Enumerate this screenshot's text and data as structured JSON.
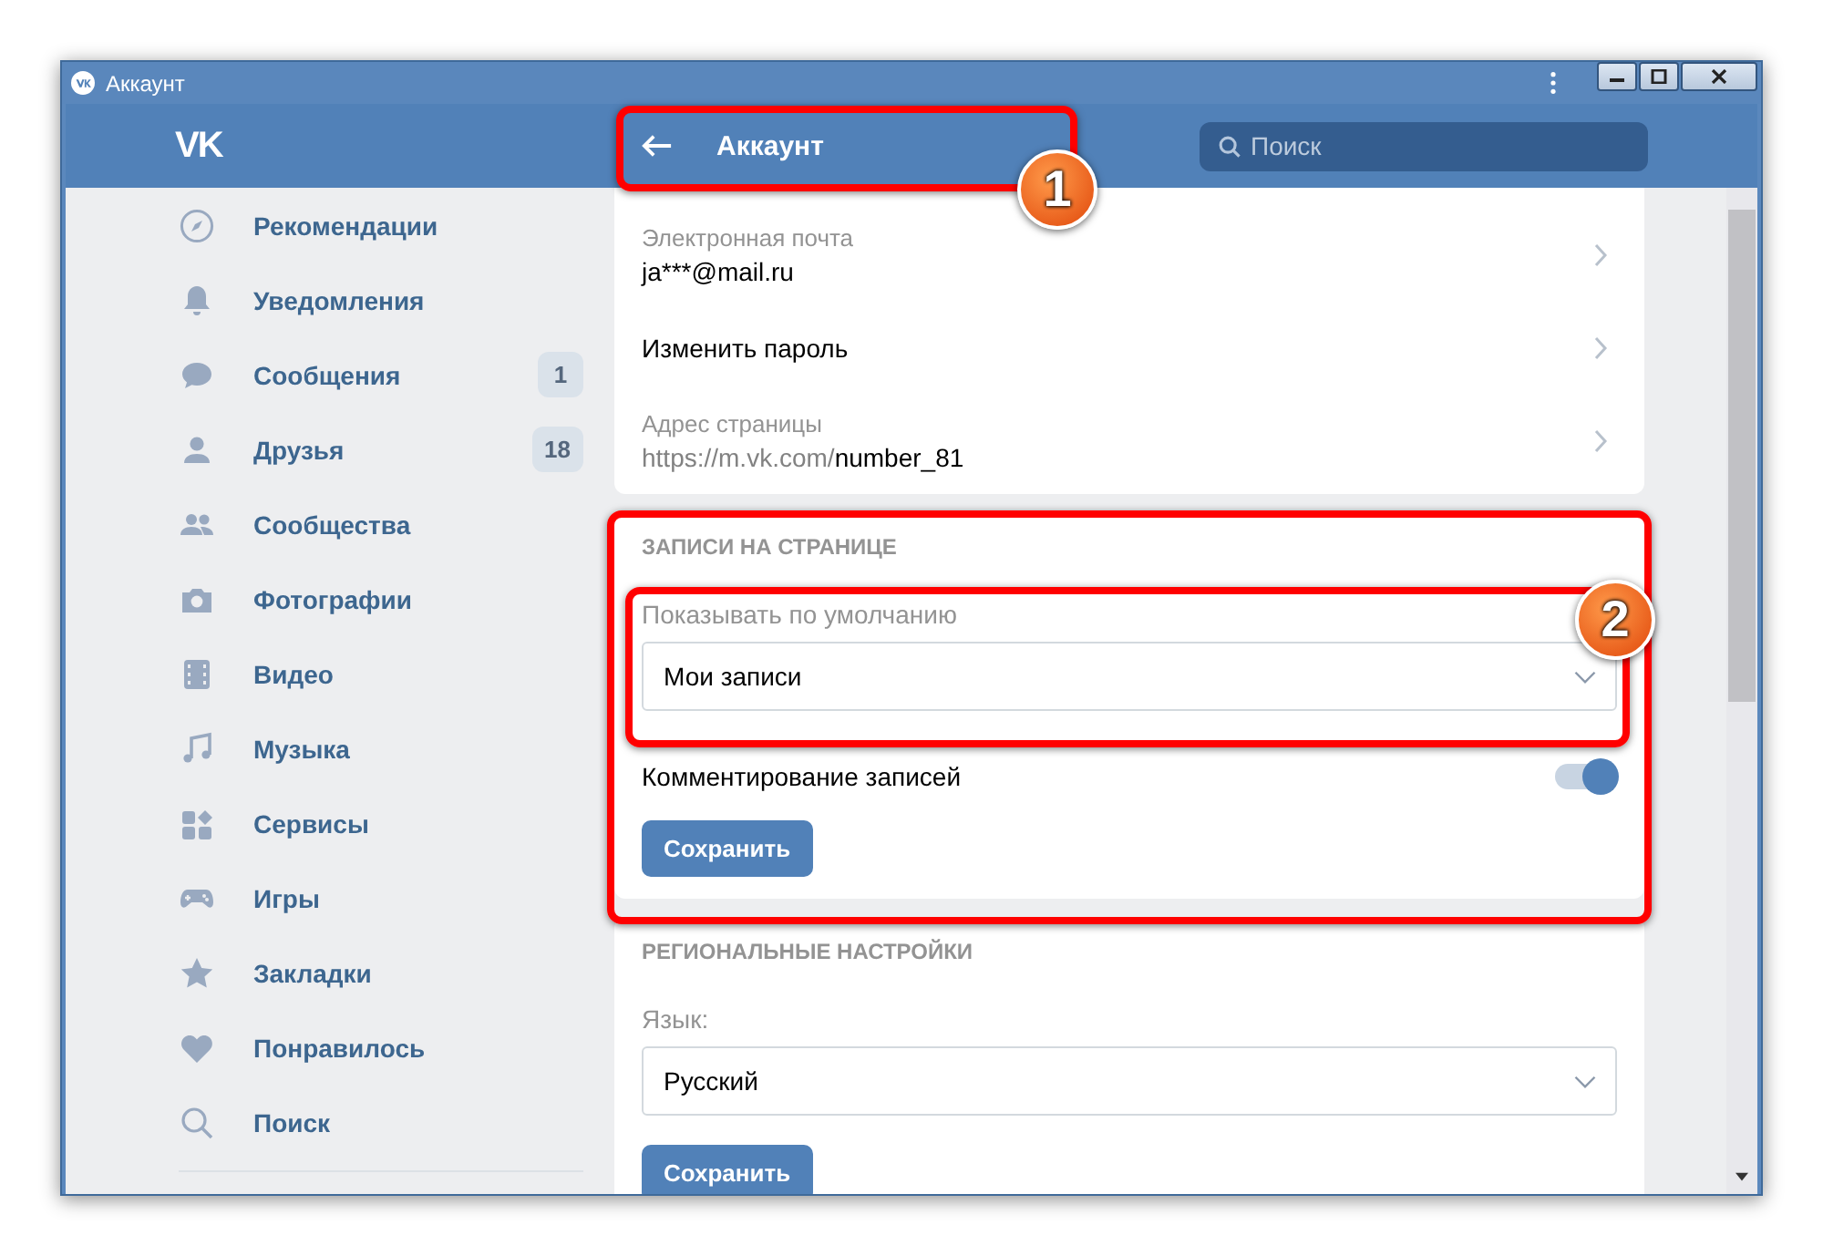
{
  "window": {
    "title": "Аккаунт"
  },
  "header": {
    "logo": "VK",
    "title": "Аккаунт",
    "search": {
      "placeholder": "Поиск"
    }
  },
  "sidebar": {
    "items": [
      {
        "label": "Рекомендации"
      },
      {
        "label": "Уведомления"
      },
      {
        "label": "Сообщения",
        "count": "1"
      },
      {
        "label": "Друзья",
        "count": "18"
      },
      {
        "label": "Сообщества"
      },
      {
        "label": "Фотографии"
      },
      {
        "label": "Видео"
      },
      {
        "label": "Музыка"
      },
      {
        "label": "Сервисы"
      },
      {
        "label": "Игры"
      },
      {
        "label": "Закладки"
      },
      {
        "label": "Понравилось"
      },
      {
        "label": "Поиск"
      }
    ]
  },
  "account": {
    "email": {
      "label": "Электронная почта",
      "value": "ja***@mail.ru"
    },
    "password": {
      "label": "Изменить пароль"
    },
    "address": {
      "label": "Адрес страницы",
      "prefix": "https://m.vk.com/",
      "value": "number_81"
    }
  },
  "posts": {
    "heading": "ЗАПИСИ НА СТРАНИЦЕ",
    "default_label": "Показывать по умолчанию",
    "default_value": "Мои записи",
    "comments": {
      "label": "Комментирование записей",
      "on": true
    },
    "save": "Сохранить"
  },
  "regional": {
    "heading": "РЕГИОНАЛЬНЫЕ НАСТРОЙКИ",
    "language_label": "Язык:",
    "language_value": "Русский",
    "save": "Сохранить"
  },
  "annotations": [
    {
      "label": "1"
    },
    {
      "label": "2"
    }
  ]
}
